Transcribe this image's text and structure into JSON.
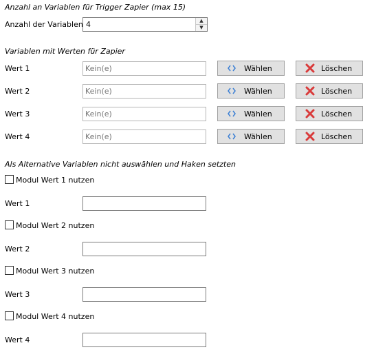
{
  "count_section": {
    "title": "Anzahl an Variablen für Trigger Zapier (max 15)",
    "label": "Anzahl der Variablen",
    "value": "4"
  },
  "vars_section": {
    "title": "Variablen mit Werten für Zapier",
    "rows": [
      {
        "label": "Wert 1",
        "placeholder": "Kein(e)",
        "choose": "Wählen",
        "delete": "Löschen"
      },
      {
        "label": "Wert 2",
        "placeholder": "Kein(e)",
        "choose": "Wählen",
        "delete": "Löschen"
      },
      {
        "label": "Wert 3",
        "placeholder": "Kein(e)",
        "choose": "Wählen",
        "delete": "Löschen"
      },
      {
        "label": "Wert 4",
        "placeholder": "Kein(e)",
        "choose": "Wählen",
        "delete": "Löschen"
      }
    ]
  },
  "alt_section": {
    "title": "Als Alternative Variablen nicht auswählen und Haken setzten",
    "items": [
      {
        "checkbox_label": "Modul Wert 1 nutzen",
        "checked": false,
        "field_label": "Wert 1",
        "value": ""
      },
      {
        "checkbox_label": "Modul Wert 2 nutzen",
        "checked": false,
        "field_label": "Wert 2",
        "value": ""
      },
      {
        "checkbox_label": "Modul Wert 3 nutzen",
        "checked": false,
        "field_label": "Wert 3",
        "value": ""
      },
      {
        "checkbox_label": "Modul Wert 4 nutzen",
        "checked": false,
        "field_label": "Wert 4",
        "value": ""
      }
    ]
  },
  "icons": {
    "choose": "code-brackets-icon",
    "delete": "red-x-icon"
  },
  "colors": {
    "choose_icon": "#3b7fd4",
    "delete_icon": "#d93a3a",
    "button_bg": "#e1e1e1"
  }
}
